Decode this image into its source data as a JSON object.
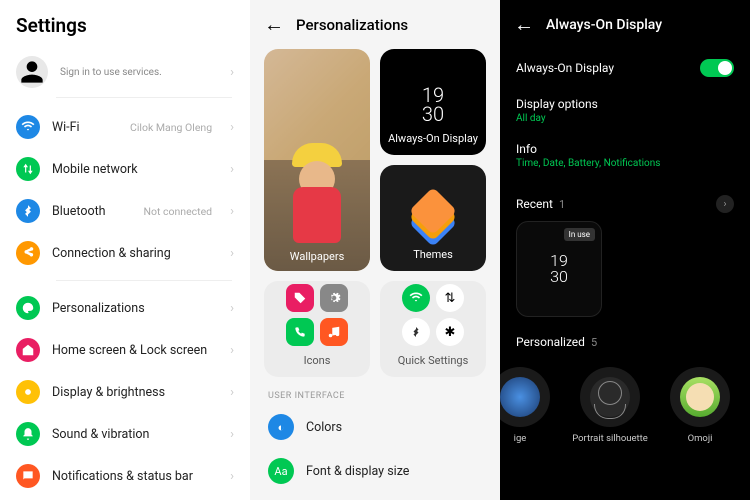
{
  "panelA": {
    "title": "Settings",
    "account_sub": "Sign in to use services.",
    "items": [
      {
        "label": "Wi-Fi",
        "value": "Cilok Mang Oleng",
        "color": "#1e88e5",
        "icon": "wifi"
      },
      {
        "label": "Mobile network",
        "value": "",
        "color": "#00c853",
        "icon": "updown"
      },
      {
        "label": "Bluetooth",
        "value": "Not connected",
        "color": "#1e88e5",
        "icon": "bt"
      },
      {
        "label": "Connection & sharing",
        "value": "",
        "color": "#ff9800",
        "icon": "share"
      }
    ],
    "items2": [
      {
        "label": "Personalizations",
        "color": "#00c853",
        "icon": "paint"
      },
      {
        "label": "Home screen & Lock screen",
        "color": "#e91e63",
        "icon": "home"
      },
      {
        "label": "Display & brightness",
        "color": "#ffc107",
        "icon": "sun"
      },
      {
        "label": "Sound & vibration",
        "color": "#00c853",
        "icon": "bell"
      },
      {
        "label": "Notifications & status bar",
        "color": "#ff5722",
        "icon": "notif"
      }
    ]
  },
  "panelB": {
    "title": "Personalizations",
    "cards": {
      "wallpapers": "Wallpapers",
      "aod": "Always-On Display",
      "aod_time_top": "19",
      "aod_time_bot": "30",
      "themes": "Themes",
      "icons": "Icons",
      "qs": "Quick Settings"
    },
    "section": "USER INTERFACE",
    "rows": [
      {
        "label": "Colors",
        "color": "#1e88e5",
        "glyph": "◐"
      },
      {
        "label": "Font & display size",
        "color": "#00c853",
        "glyph": "Aa"
      }
    ]
  },
  "panelC": {
    "title": "Always-On Display",
    "toggle_label": "Always-On Display",
    "display_options": "Display options",
    "display_options_sub": "All day",
    "info": "Info",
    "info_sub": "Time, Date, Battery, Notifications",
    "recent": "Recent",
    "recent_count": "1",
    "in_use": "In use",
    "prev_top": "19",
    "prev_bot": "30",
    "personalized": "Personalized",
    "personalized_count": "5",
    "avatars": [
      {
        "label": "ige",
        "kind": "gem"
      },
      {
        "label": "Portrait silhouette",
        "kind": "port"
      },
      {
        "label": "Omoji",
        "kind": "omoji"
      }
    ]
  }
}
